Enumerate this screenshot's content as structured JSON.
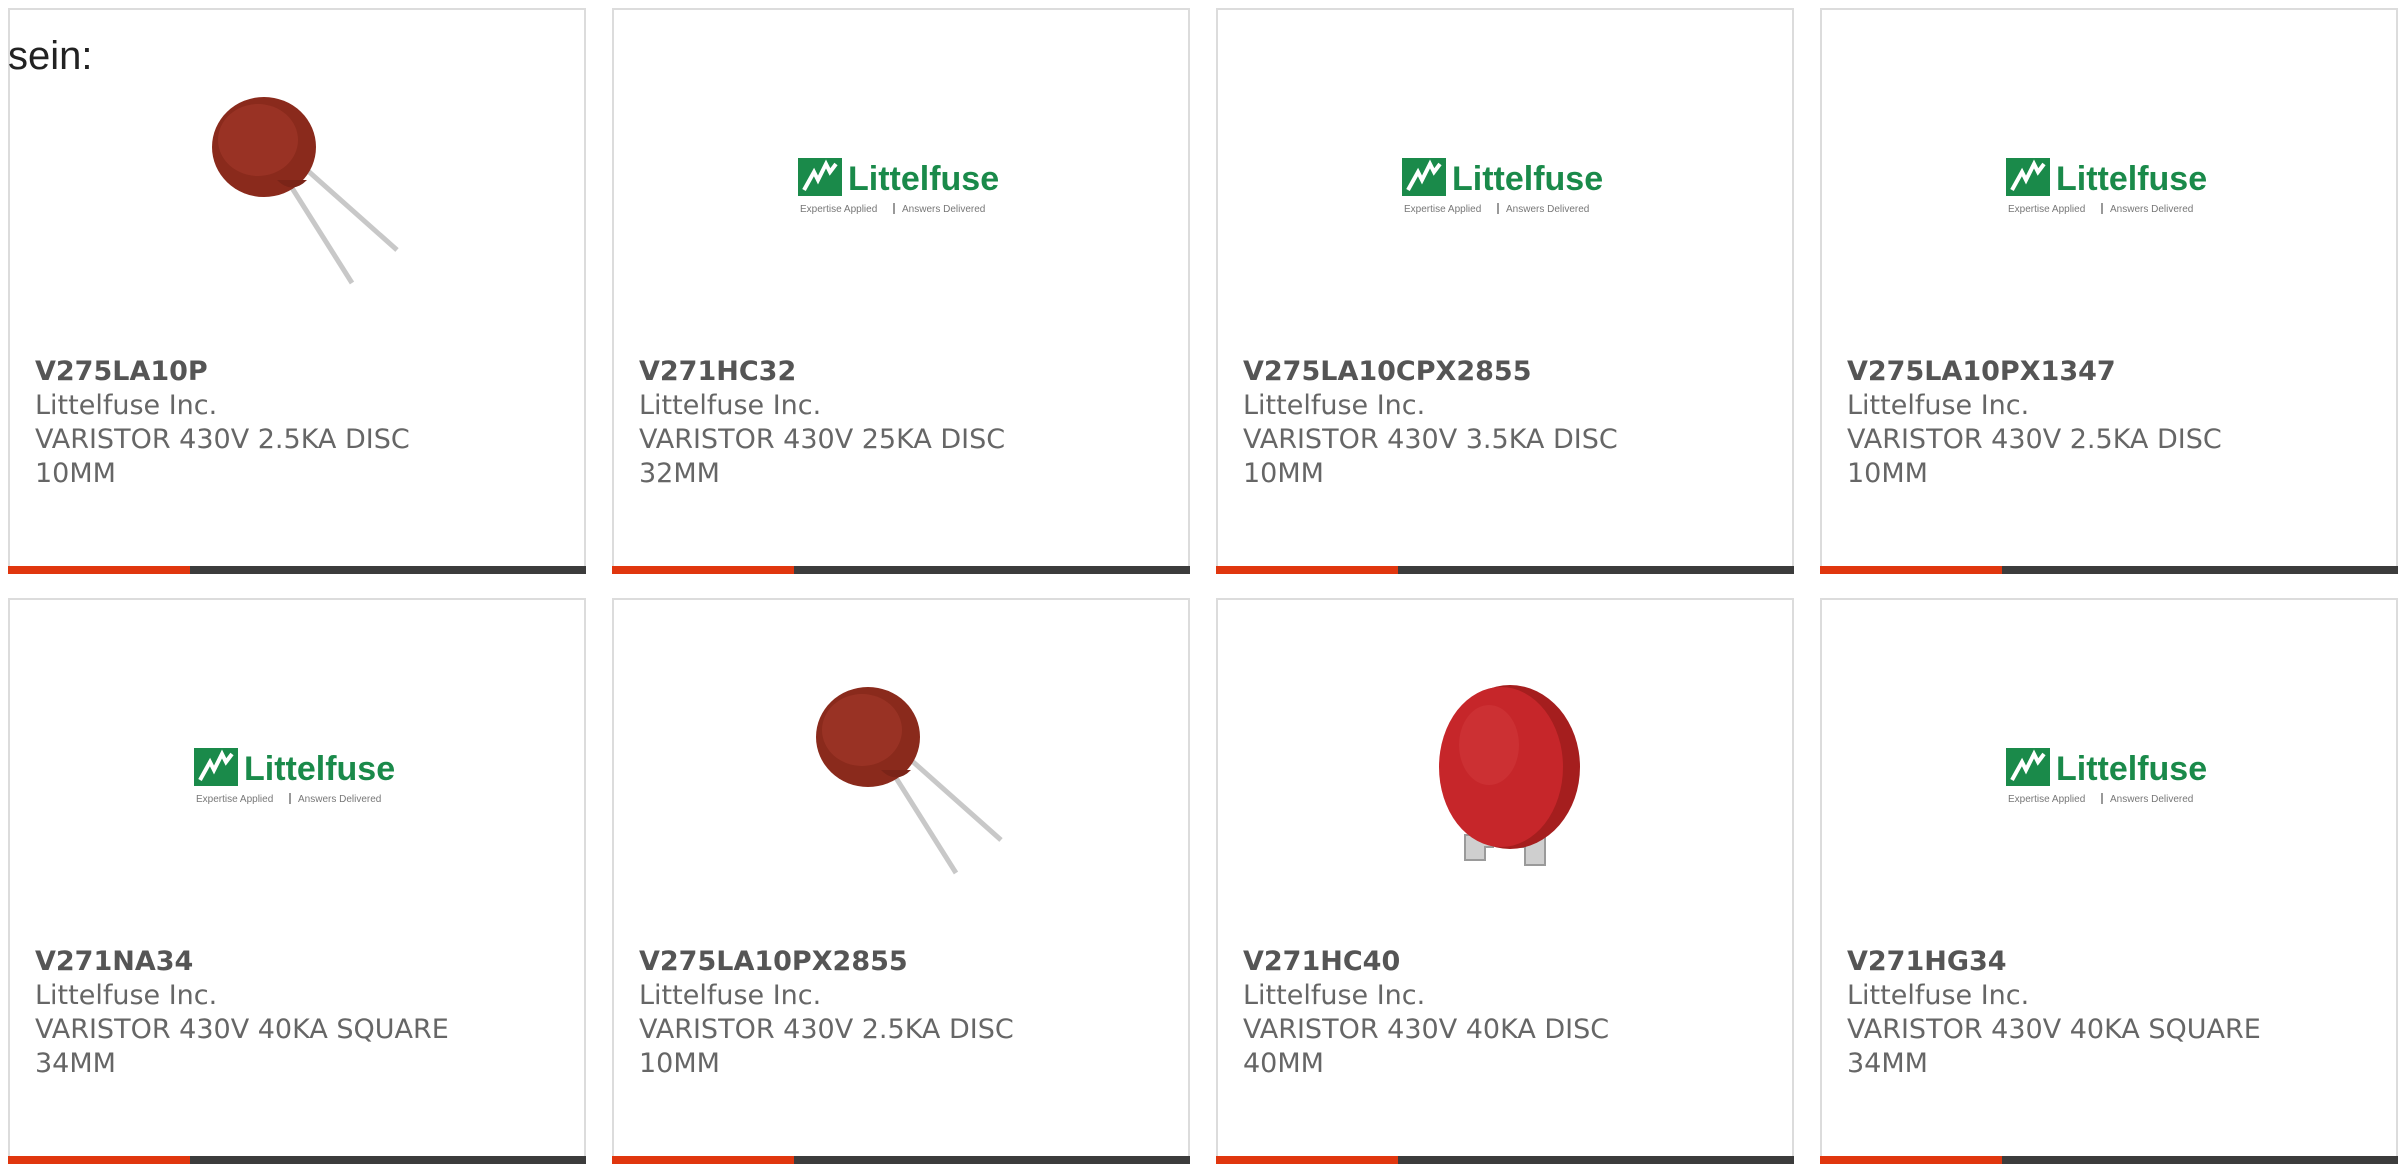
{
  "intro_text": "sein:",
  "colors": {
    "accent": "#e0360e",
    "bar_dark": "#3c3c3c",
    "logo_green": "#1a8a4a"
  },
  "logo": {
    "name": "Littelfuse",
    "tagline_left": "Expertise Applied",
    "tagline_right": "Answers Delivered"
  },
  "products": [
    {
      "part_number": "V275LA10P",
      "manufacturer": "Littelfuse Inc.",
      "description": "VARISTOR 430V 2.5KA DISC 10MM",
      "image": "radial-disc-varistor-icon"
    },
    {
      "part_number": "V271HC32",
      "manufacturer": "Littelfuse Inc.",
      "description": "VARISTOR 430V 25KA DISC 32MM",
      "image": "littelfuse-logo"
    },
    {
      "part_number": "V275LA10CPX2855",
      "manufacturer": "Littelfuse Inc.",
      "description": "VARISTOR 430V 3.5KA DISC 10MM",
      "image": "littelfuse-logo"
    },
    {
      "part_number": "V275LA10PX1347",
      "manufacturer": "Littelfuse Inc.",
      "description": "VARISTOR 430V 2.5KA DISC 10MM",
      "image": "littelfuse-logo"
    },
    {
      "part_number": "V271NA34",
      "manufacturer": "Littelfuse Inc.",
      "description": "VARISTOR 430V 40KA SQUARE 34MM",
      "image": "littelfuse-logo"
    },
    {
      "part_number": "V275LA10PX2855",
      "manufacturer": "Littelfuse Inc.",
      "description": "VARISTOR 430V 2.5KA DISC 10MM",
      "image": "radial-disc-varistor-icon"
    },
    {
      "part_number": "V271HC40",
      "manufacturer": "Littelfuse Inc.",
      "description": "VARISTOR 430V 40KA DISC 40MM",
      "image": "large-disc-varistor-icon"
    },
    {
      "part_number": "V271HG34",
      "manufacturer": "Littelfuse Inc.",
      "description": "VARISTOR 430V 40KA SQUARE 34MM",
      "image": "littelfuse-logo"
    }
  ]
}
